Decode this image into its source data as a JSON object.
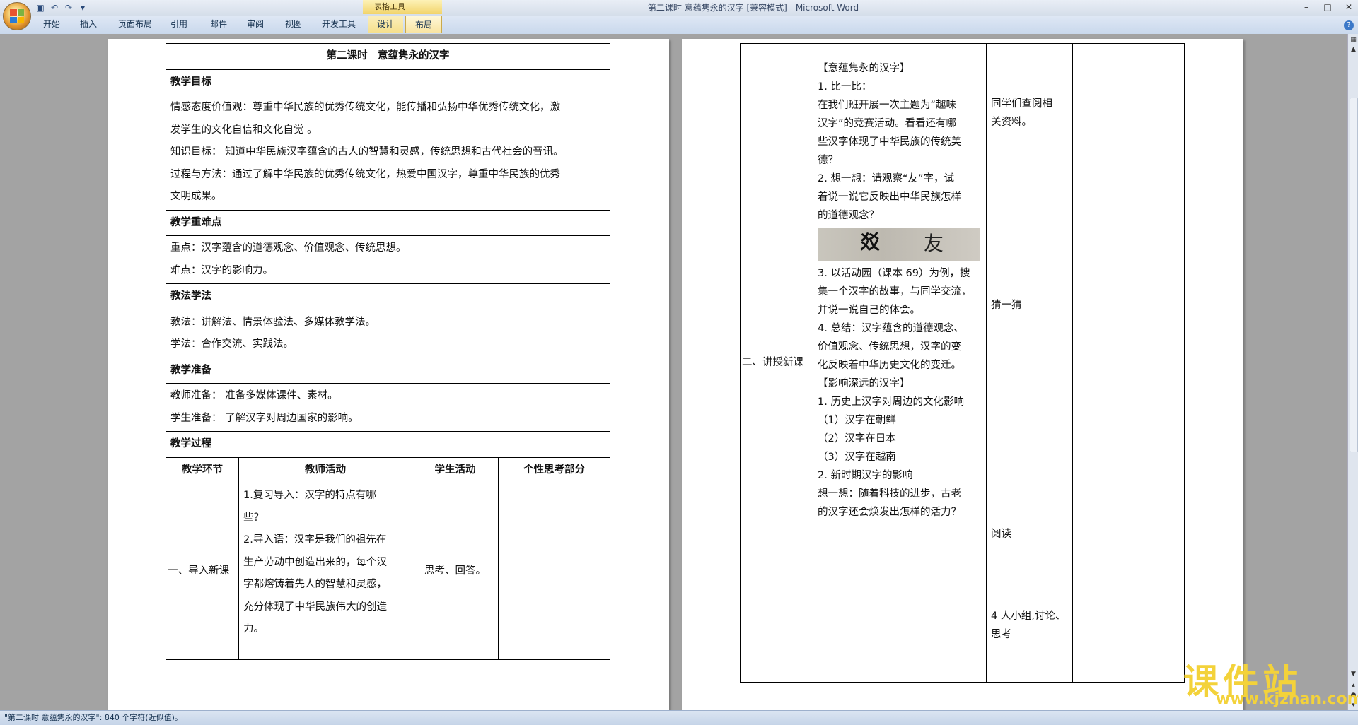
{
  "window": {
    "title": "第二课时  意蕴隽永的汉字 [兼容模式] - Microsoft Word",
    "context_group": "表格工具"
  },
  "tabs": [
    "开始",
    "插入",
    "页面布局",
    "引用",
    "邮件",
    "审阅",
    "视图",
    "开发工具",
    "设计",
    "布局"
  ],
  "left_page": {
    "title": "第二课时　意蕴隽永的汉字",
    "goal_heading": "教学目标",
    "goal_lines": [
      "情感态度价值观：尊重中华民族的优秀传统文化，能传播和弘扬中华优秀传统文化，激",
      "发学生的文化自信和文化自觉 。",
      "知识目标： 知道中华民族汉字蕴含的古人的智慧和灵感，传统思想和古代社会的音讯。",
      "过程与方法：通过了解中华民族的优秀传统文化，热爱中国汉字，尊重中华民族的优秀",
      "文明成果。"
    ],
    "key_heading": "教学重难点",
    "key_lines": [
      "重点：汉字蕴含的道德观念、价值观念、传统思想。",
      "难点：汉字的影响力。"
    ],
    "method_heading": "教法学法",
    "method_lines": [
      "教法：讲解法、情景体验法、多媒体教学法。",
      "学法：合作交流、实践法。"
    ],
    "prep_heading": "教学准备",
    "prep_lines": [
      "教师准备： 准备多媒体课件、素材。",
      "学生准备： 了解汉字对周边国家的影响。"
    ],
    "process_heading": "教学过程",
    "col_headers": [
      "教学环节",
      "教师活动",
      "学生活动",
      "个性思考部分"
    ],
    "row1": {
      "stage": "一、导入新课",
      "teacher": [
        "1.复习导入：汉字的特点有哪",
        "些？",
        "2.导入语：汉字是我们的祖先在",
        "生产劳动中创造出来的，每个汉",
        "字都熔铸着先人的智慧和灵感，",
        "充分体现了中华民族伟大的创造",
        "力。"
      ],
      "student": "思考、回答。"
    }
  },
  "right_page": {
    "stage": "二、讲授新课",
    "teacher": [
      "【意蕴隽永的汉字】",
      "1. 比一比：",
      "在我们班开展一次主题为“趣味",
      "汉字”的竞赛活动。看看还有哪",
      "些汉字体现了中华民族的传统美",
      "德？",
      "2. 想一想：请观察“友”字，试",
      "着说一说它反映出中华民族怎样",
      "的道德观念？",
      "3. 以活动园（课本 69）为例，搜",
      "集一个汉字的故事，与同学交流，",
      "并说一说自己的体会。",
      "4. 总结：汉字蕴含的道德观念、",
      "价值观念、传统思想，汉字的变",
      "化反映着中华历史文化的变迁。",
      "【影响深远的汉字】",
      "1. 历史上汉字对周边的文化影响",
      "（1）汉字在朝鲜",
      "（2）汉字在日本",
      "（3）汉字在越南",
      "2. 新时期汉字的影响",
      "想一想：随着科技的进步，古老",
      "的汉字还会焕发出怎样的活力？"
    ],
    "image_glyphs": [
      "㸚",
      "友"
    ],
    "student": {
      "s1a": "同学们查阅相",
      "s1b": "关资料。",
      "s2": "猜一猜",
      "s3": "阅读",
      "s4a": "4 人小组,讨论、",
      "s4b": "思考"
    }
  },
  "status": {
    "text": "\"第二课时  意蕴隽永的汉字\": 840 个字符(近似值)。"
  },
  "watermark": {
    "cn": "课件站",
    "url": "www.kjzhan.com"
  }
}
